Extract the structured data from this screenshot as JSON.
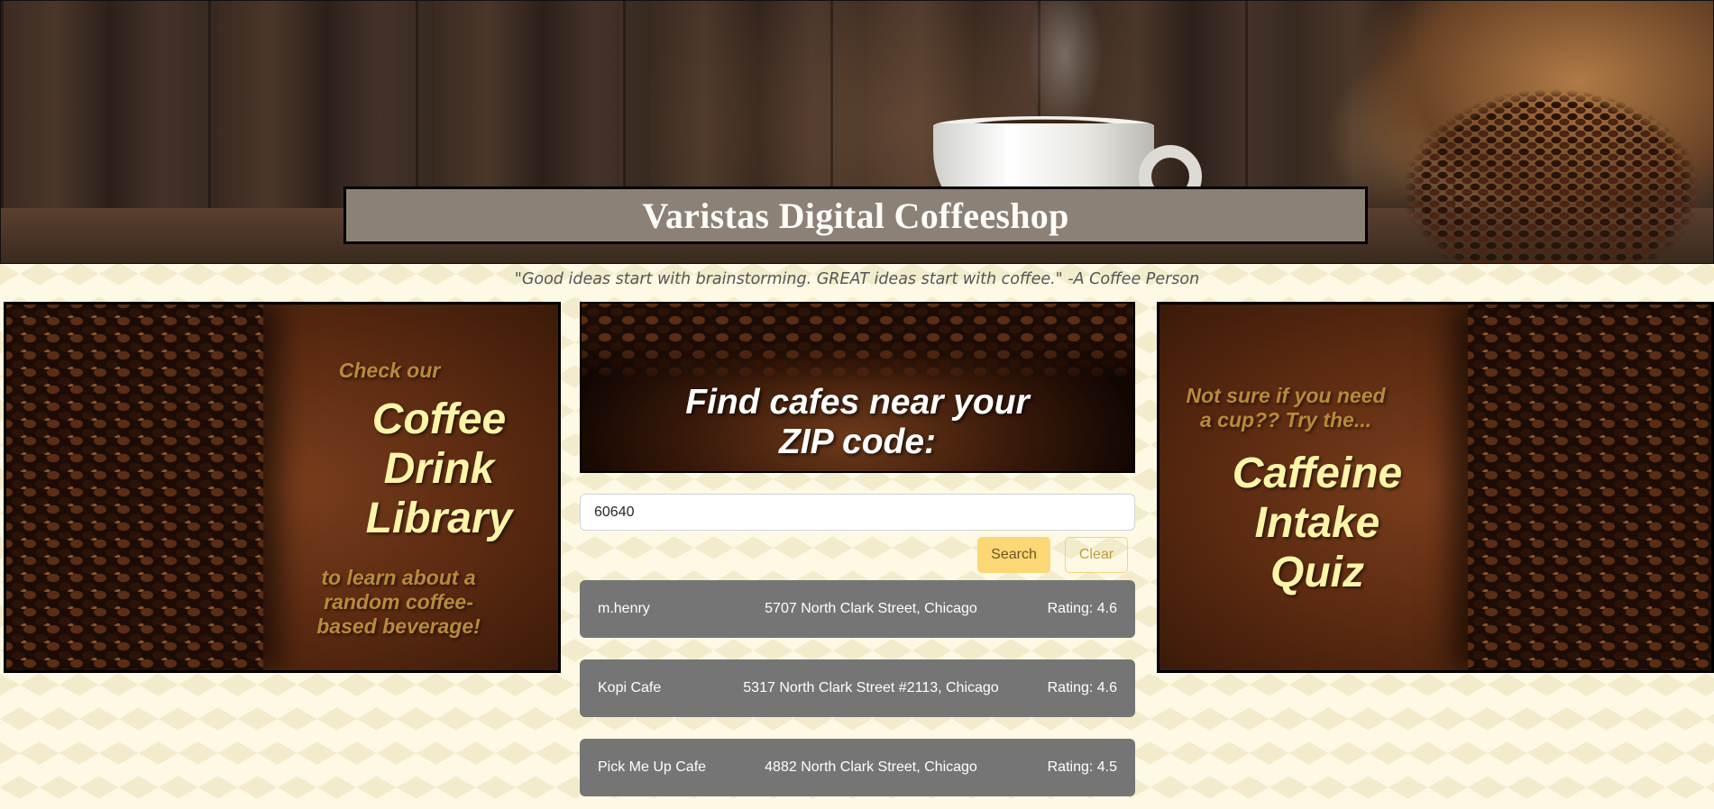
{
  "header": {
    "title": "Varistas Digital Coffeeshop",
    "quote": "\"Good ideas start with brainstorming. GREAT ideas start with coffee.\" -A Coffee Person"
  },
  "left_promo": {
    "line1": "Check our",
    "title_lines": [
      "Coffee",
      "Drink",
      "Library"
    ],
    "tagline_lines": [
      "to learn about a",
      "random coffee-",
      "based beverage!"
    ]
  },
  "right_promo": {
    "line1": [
      "Not sure if you need",
      "a cup?? Try the..."
    ],
    "title_lines": [
      "Caffeine",
      "Intake",
      "Quiz"
    ]
  },
  "search": {
    "banner_lines": [
      "Find cafes near your",
      "ZIP code:"
    ],
    "zip_value": "60640",
    "search_label": "Search",
    "clear_label": "Clear"
  },
  "cafes": [
    {
      "name": "m.henry",
      "address": "5707 North Clark Street, Chicago",
      "rating": "Rating: 4.6"
    },
    {
      "name": "Kopi Cafe",
      "address": "5317 North Clark Street #2113, Chicago",
      "rating": "Rating: 4.6"
    },
    {
      "name": "Pick Me Up Cafe",
      "address": "4882 North Clark Street, Chicago",
      "rating": "Rating: 4.5"
    }
  ],
  "colors": {
    "page_background": "#fdf9e4",
    "title_box": "#8c8177",
    "card_background": "#757575",
    "search_button": "#fcd775",
    "promo_gold": "#b98a3a",
    "promo_cream": "#fff5a8"
  }
}
